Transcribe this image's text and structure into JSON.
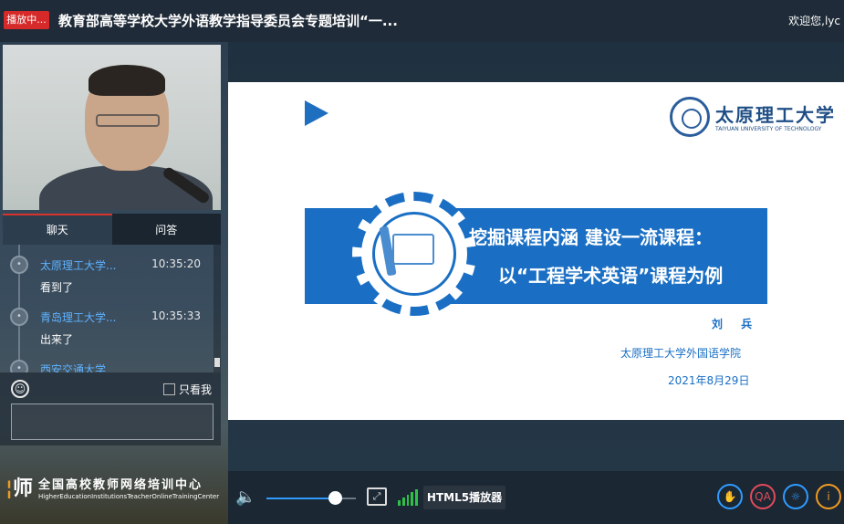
{
  "header": {
    "live_badge": "播放中...",
    "title": "教育部高等学校大学外语教学指导委员会专题培训“一...",
    "welcome": "欢迎您,lyc"
  },
  "tabs": [
    {
      "label": "聊天"
    },
    {
      "label": "问答"
    }
  ],
  "chat": {
    "messages": [
      {
        "user": "太原理工大学...",
        "time": "10:35:20",
        "text": "看到了"
      },
      {
        "user": "青岛理工大学...",
        "time": "10:35:33",
        "text": "出来了"
      },
      {
        "user": "西安交通大学",
        "time": "",
        "text": ""
      }
    ],
    "only_me_label": "只看我"
  },
  "logo": {
    "mark": "师",
    "cn": "全国高校教师网络培训中心",
    "en": "HigherEducationInstitutionsTeacherOnlineTrainingCenter"
  },
  "slide": {
    "university_cn": "太原理工大学",
    "university_en": "TAIYUAN UNIVERSITY OF TECHNOLOGY",
    "title_line1": "挖掘课程内涵  建设一流课程：",
    "title_line2": "以“工程学术英语”课程为例",
    "author": "刘 兵",
    "institution": "太原理工大学外国语学院",
    "date": "2021年8月29日"
  },
  "toolbar": {
    "volume_level": 0.77,
    "html5_label": "HTML5播放器",
    "hand_label": "✋",
    "qa_label": "QA",
    "light_label": "☼",
    "info_label": "i"
  },
  "colors": {
    "accent_blue": "#1a6fc4",
    "live_red": "#d62a2a",
    "chat_user": "#5fb2ff"
  }
}
